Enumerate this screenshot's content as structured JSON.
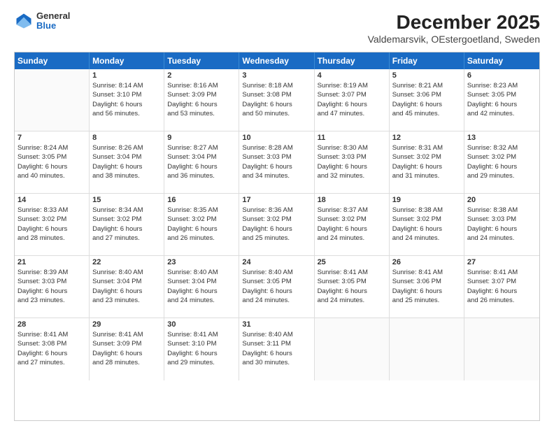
{
  "logo": {
    "general": "General",
    "blue": "Blue"
  },
  "header": {
    "title": "December 2025",
    "subtitle": "Valdemarsvik, OEstergoetland, Sweden"
  },
  "days": [
    "Sunday",
    "Monday",
    "Tuesday",
    "Wednesday",
    "Thursday",
    "Friday",
    "Saturday"
  ],
  "weeks": [
    [
      {
        "day": "",
        "lines": []
      },
      {
        "day": "1",
        "lines": [
          "Sunrise: 8:14 AM",
          "Sunset: 3:10 PM",
          "Daylight: 6 hours",
          "and 56 minutes."
        ]
      },
      {
        "day": "2",
        "lines": [
          "Sunrise: 8:16 AM",
          "Sunset: 3:09 PM",
          "Daylight: 6 hours",
          "and 53 minutes."
        ]
      },
      {
        "day": "3",
        "lines": [
          "Sunrise: 8:18 AM",
          "Sunset: 3:08 PM",
          "Daylight: 6 hours",
          "and 50 minutes."
        ]
      },
      {
        "day": "4",
        "lines": [
          "Sunrise: 8:19 AM",
          "Sunset: 3:07 PM",
          "Daylight: 6 hours",
          "and 47 minutes."
        ]
      },
      {
        "day": "5",
        "lines": [
          "Sunrise: 8:21 AM",
          "Sunset: 3:06 PM",
          "Daylight: 6 hours",
          "and 45 minutes."
        ]
      },
      {
        "day": "6",
        "lines": [
          "Sunrise: 8:23 AM",
          "Sunset: 3:05 PM",
          "Daylight: 6 hours",
          "and 42 minutes."
        ]
      }
    ],
    [
      {
        "day": "7",
        "lines": [
          "Sunrise: 8:24 AM",
          "Sunset: 3:05 PM",
          "Daylight: 6 hours",
          "and 40 minutes."
        ]
      },
      {
        "day": "8",
        "lines": [
          "Sunrise: 8:26 AM",
          "Sunset: 3:04 PM",
          "Daylight: 6 hours",
          "and 38 minutes."
        ]
      },
      {
        "day": "9",
        "lines": [
          "Sunrise: 8:27 AM",
          "Sunset: 3:04 PM",
          "Daylight: 6 hours",
          "and 36 minutes."
        ]
      },
      {
        "day": "10",
        "lines": [
          "Sunrise: 8:28 AM",
          "Sunset: 3:03 PM",
          "Daylight: 6 hours",
          "and 34 minutes."
        ]
      },
      {
        "day": "11",
        "lines": [
          "Sunrise: 8:30 AM",
          "Sunset: 3:03 PM",
          "Daylight: 6 hours",
          "and 32 minutes."
        ]
      },
      {
        "day": "12",
        "lines": [
          "Sunrise: 8:31 AM",
          "Sunset: 3:02 PM",
          "Daylight: 6 hours",
          "and 31 minutes."
        ]
      },
      {
        "day": "13",
        "lines": [
          "Sunrise: 8:32 AM",
          "Sunset: 3:02 PM",
          "Daylight: 6 hours",
          "and 29 minutes."
        ]
      }
    ],
    [
      {
        "day": "14",
        "lines": [
          "Sunrise: 8:33 AM",
          "Sunset: 3:02 PM",
          "Daylight: 6 hours",
          "and 28 minutes."
        ]
      },
      {
        "day": "15",
        "lines": [
          "Sunrise: 8:34 AM",
          "Sunset: 3:02 PM",
          "Daylight: 6 hours",
          "and 27 minutes."
        ]
      },
      {
        "day": "16",
        "lines": [
          "Sunrise: 8:35 AM",
          "Sunset: 3:02 PM",
          "Daylight: 6 hours",
          "and 26 minutes."
        ]
      },
      {
        "day": "17",
        "lines": [
          "Sunrise: 8:36 AM",
          "Sunset: 3:02 PM",
          "Daylight: 6 hours",
          "and 25 minutes."
        ]
      },
      {
        "day": "18",
        "lines": [
          "Sunrise: 8:37 AM",
          "Sunset: 3:02 PM",
          "Daylight: 6 hours",
          "and 24 minutes."
        ]
      },
      {
        "day": "19",
        "lines": [
          "Sunrise: 8:38 AM",
          "Sunset: 3:02 PM",
          "Daylight: 6 hours",
          "and 24 minutes."
        ]
      },
      {
        "day": "20",
        "lines": [
          "Sunrise: 8:38 AM",
          "Sunset: 3:03 PM",
          "Daylight: 6 hours",
          "and 24 minutes."
        ]
      }
    ],
    [
      {
        "day": "21",
        "lines": [
          "Sunrise: 8:39 AM",
          "Sunset: 3:03 PM",
          "Daylight: 6 hours",
          "and 23 minutes."
        ]
      },
      {
        "day": "22",
        "lines": [
          "Sunrise: 8:40 AM",
          "Sunset: 3:04 PM",
          "Daylight: 6 hours",
          "and 23 minutes."
        ]
      },
      {
        "day": "23",
        "lines": [
          "Sunrise: 8:40 AM",
          "Sunset: 3:04 PM",
          "Daylight: 6 hours",
          "and 24 minutes."
        ]
      },
      {
        "day": "24",
        "lines": [
          "Sunrise: 8:40 AM",
          "Sunset: 3:05 PM",
          "Daylight: 6 hours",
          "and 24 minutes."
        ]
      },
      {
        "day": "25",
        "lines": [
          "Sunrise: 8:41 AM",
          "Sunset: 3:05 PM",
          "Daylight: 6 hours",
          "and 24 minutes."
        ]
      },
      {
        "day": "26",
        "lines": [
          "Sunrise: 8:41 AM",
          "Sunset: 3:06 PM",
          "Daylight: 6 hours",
          "and 25 minutes."
        ]
      },
      {
        "day": "27",
        "lines": [
          "Sunrise: 8:41 AM",
          "Sunset: 3:07 PM",
          "Daylight: 6 hours",
          "and 26 minutes."
        ]
      }
    ],
    [
      {
        "day": "28",
        "lines": [
          "Sunrise: 8:41 AM",
          "Sunset: 3:08 PM",
          "Daylight: 6 hours",
          "and 27 minutes."
        ]
      },
      {
        "day": "29",
        "lines": [
          "Sunrise: 8:41 AM",
          "Sunset: 3:09 PM",
          "Daylight: 6 hours",
          "and 28 minutes."
        ]
      },
      {
        "day": "30",
        "lines": [
          "Sunrise: 8:41 AM",
          "Sunset: 3:10 PM",
          "Daylight: 6 hours",
          "and 29 minutes."
        ]
      },
      {
        "day": "31",
        "lines": [
          "Sunrise: 8:40 AM",
          "Sunset: 3:11 PM",
          "Daylight: 6 hours",
          "and 30 minutes."
        ]
      },
      {
        "day": "",
        "lines": []
      },
      {
        "day": "",
        "lines": []
      },
      {
        "day": "",
        "lines": []
      }
    ]
  ]
}
